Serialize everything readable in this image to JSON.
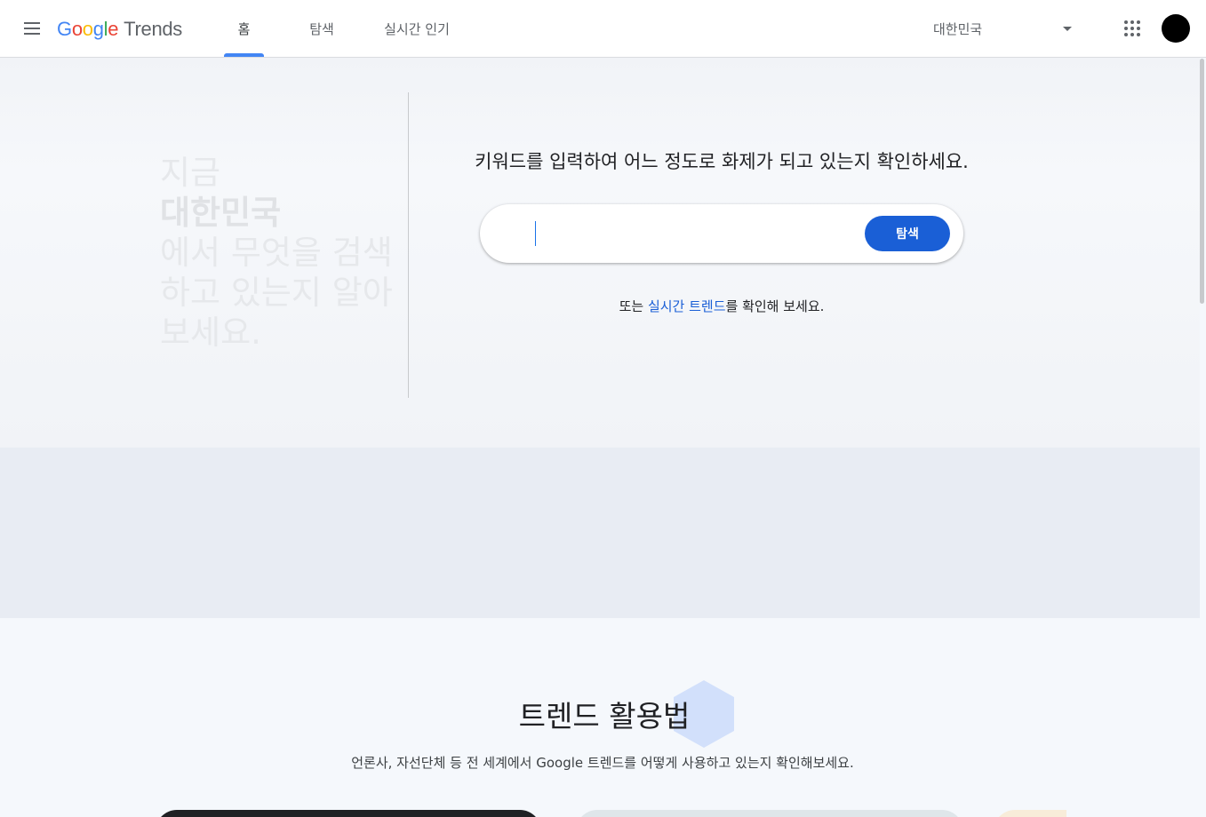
{
  "header": {
    "logo": {
      "google": [
        "G",
        "o",
        "o",
        "g",
        "l",
        "e"
      ],
      "trends": "Trends"
    },
    "tabs": [
      {
        "label": "홈",
        "active": true
      },
      {
        "label": "탐색",
        "active": false
      },
      {
        "label": "실시간 인기",
        "active": false
      }
    ],
    "region": "대한민국",
    "icons": {
      "menu": "menu-icon",
      "apps": "apps-grid-icon",
      "dropdown": "caret-down-icon"
    }
  },
  "hero": {
    "tagline_1": "지금",
    "tagline_region": "대한민국",
    "tagline_2": "에서 무엇을 검색",
    "tagline_3": "하고 있는지 알아",
    "tagline_4": "보세요.",
    "prompt": "키워드를 입력하여 어느 정도로 화제가 되고 있는지 확인하세요.",
    "search_value": "",
    "search_button": "탐색",
    "alt_prefix": "또는 ",
    "alt_link": "실시간 트렌드",
    "alt_suffix": "를 확인해 보세요."
  },
  "section": {
    "title": "트렌드 활용법",
    "description": "언론사, 자선단체 등 전 세계에서 Google 트렌드를 어떻게 사용하고 있는지 확인해보세요."
  },
  "colors": {
    "accent": "#1a5fd6",
    "tab_indicator": "#4285f4",
    "band": "#e8ecf3"
  }
}
